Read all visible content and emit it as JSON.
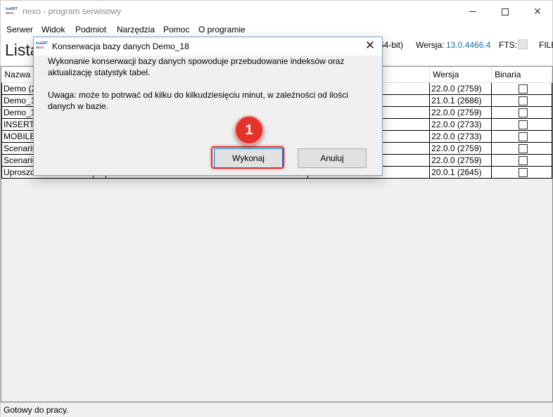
{
  "app": {
    "title": "nexo - program serwisowy",
    "logo_top": "InsERT",
    "logo_bottom_a": "ne",
    "logo_bottom_b": "xo"
  },
  "menu": [
    "Serwer",
    "Widok",
    "Podmiot",
    "Narzędzia",
    "Pomoc",
    "O programie"
  ],
  "info": {
    "page_title": "Lista",
    "bits": "64-bit)",
    "version_label": "Wersja:",
    "version_value": "13.0.4466.4",
    "fts_label": "FTS:",
    "file_label": "FILE"
  },
  "table": {
    "col_name": "Nazwa",
    "col_version": "Wersja",
    "col_binary": "Binaria",
    "rows": [
      {
        "name": "Demo (2",
        "version": "22.0.0 (2759)"
      },
      {
        "name": "Demo_1",
        "version": "21.0.1 (2686)"
      },
      {
        "name": "Demo_1",
        "version": "22.0.0 (2759)"
      },
      {
        "name": "INSERTH",
        "version": "22.0.0 (2733)"
      },
      {
        "name": "MOBILE",
        "version": "22.0.0 (2733)"
      },
      {
        "name": "Scenariu",
        "version": "22.0.0 (2759)"
      },
      {
        "name": "Scenariu",
        "version": "22.0.0 (2759)"
      },
      {
        "name": "Uproszc",
        "version": "20.0.1 (2645)"
      }
    ]
  },
  "status": "Gotowy do pracy.",
  "dialog": {
    "title": "Konserwacja bazy danych Demo_18",
    "message": "Wykonanie konserwacji bazy danych spowoduje przebudowanie indeksów oraz aktualizację statystyk tabel.",
    "warning": "Uwaga: może to potrwać od kilku do kilkudziesięciu minut, w zależności od ilości danych w bazie.",
    "ok_label": "Wykonaj",
    "cancel_label": "Anuluj"
  },
  "annotation": {
    "step": "1",
    "color": "#e5322b"
  }
}
